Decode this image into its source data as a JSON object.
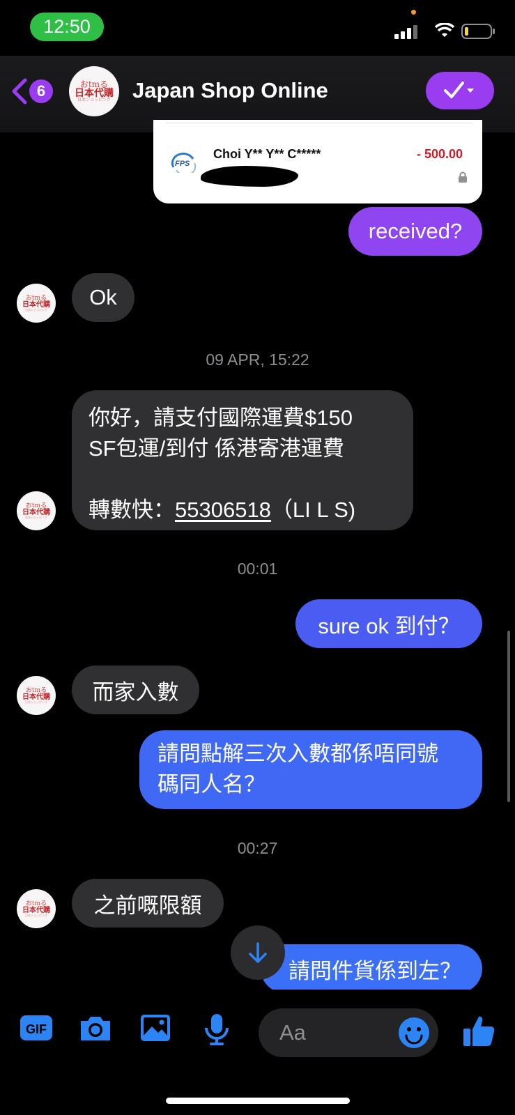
{
  "status_bar": {
    "time": "12:50",
    "time_pill_color": "#2fbf47"
  },
  "header": {
    "back_count": "6",
    "contact_name": "Japan Shop Online",
    "accent": "#9a3df1",
    "logo": {
      "line1": "おtmる",
      "line2": "日本代購",
      "line3": "日本ショッピング"
    }
  },
  "payment_card": {
    "payee": "Choi Y** Y** C*****",
    "amount": "- 500.00",
    "brand": "FPS"
  },
  "messages": [
    {
      "from": "me",
      "text": "received?"
    },
    {
      "from": "shop",
      "text": "Ok"
    },
    {
      "type": "timestamp",
      "text": "09 APR, 15:22"
    },
    {
      "from": "shop",
      "line1": "你好，請支付國際運費$150",
      "line2": "SF包運/到付 係港寄港運費",
      "line4_prefix": "轉數快：",
      "fps_number": "55306518",
      "line4_suffix": "（LI L S)"
    },
    {
      "type": "timestamp",
      "text": "00:01"
    },
    {
      "from": "me",
      "text": "sure ok 到付？"
    },
    {
      "from": "shop",
      "text": "而家入數"
    },
    {
      "from": "me",
      "line1": "請問點解三次入數都係唔同號",
      "line2": "碼同人名？"
    },
    {
      "type": "timestamp",
      "text": "00:27"
    },
    {
      "from": "shop",
      "text": "之前嘅限額"
    },
    {
      "from": "me",
      "text": "請問件貨係到左？"
    }
  ],
  "composer": {
    "placeholder": "Aa",
    "icon_color": "#2d85f5"
  }
}
